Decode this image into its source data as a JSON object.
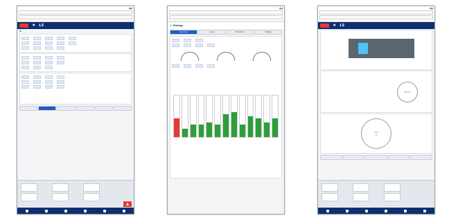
{
  "panel2": {
    "section_title": "Energy",
    "tabs": [
      "Overview",
      "Cycle",
      "Production",
      "Setting"
    ],
    "active_tab": "Overview",
    "bar_values": [
      0.45,
      0.2,
      0.3,
      0.3,
      0.35,
      0.3,
      0.55,
      0.6,
      0.3,
      0.5,
      0.45,
      0.35,
      0.45
    ],
    "bar_highlight_color": "#e53935",
    "bar_color": "#2e9e3c"
  },
  "panel3": {
    "circle1": "12.0 s",
    "circle2": "12 s",
    "header_icons": [
      "bell-icon",
      "star-icon"
    ]
  },
  "colors": {
    "header_navy": "#0d2f6e",
    "accent_blue": "#1f5cc5",
    "alarm_red": "#e53935"
  }
}
